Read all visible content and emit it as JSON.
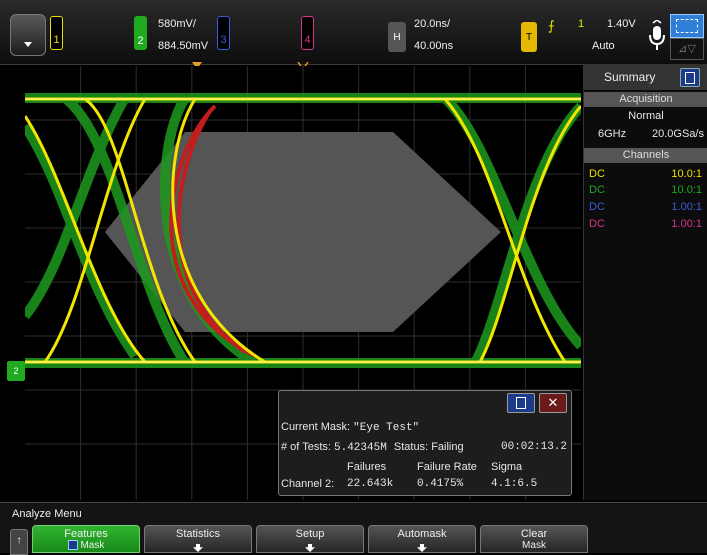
{
  "topbar": {
    "ch1": {
      "num": "1",
      "color": "#e8e000"
    },
    "ch2": {
      "num": "2",
      "color": "#1faa1f",
      "scale": "580mV/",
      "offset": "884.50mV"
    },
    "ch3": {
      "num": "3",
      "color": "#3b5bdb"
    },
    "ch4": {
      "num": "4",
      "color": "#d6338a"
    },
    "horizontal": {
      "label": "H",
      "timebase": "20.0ns/",
      "position": "40.00ns"
    },
    "trigger": {
      "label": "T",
      "source": "1",
      "level": "1.40V",
      "mode": "Auto"
    }
  },
  "side_panel": {
    "header": "Summary",
    "acquisition": {
      "title": "Acquisition",
      "mode": "Normal",
      "bandwidth": "6GHz",
      "rate": "20.0GSa/s"
    },
    "channels": {
      "title": "Channels",
      "rows": [
        {
          "coupling": "DC",
          "ratio": "10.0:1",
          "color": "#e8e000"
        },
        {
          "coupling": "DC",
          "ratio": "10.0:1",
          "color": "#1faa1f"
        },
        {
          "coupling": "DC",
          "ratio": "1.00:1",
          "color": "#3b5bdb"
        },
        {
          "coupling": "DC",
          "ratio": "1.00:1",
          "color": "#d6338a"
        }
      ]
    }
  },
  "mask_popup": {
    "current_mask_label": "Current Mask:",
    "current_mask_value": "\"Eye Test\"",
    "tests_label": "# of Tests:",
    "tests_value": "5.42345M",
    "status_label": "Status:",
    "status_value": "Failing",
    "elapsed": "00:02:13.2",
    "col_failures": "Failures",
    "col_rate": "Failure Rate",
    "col_sigma": "Sigma",
    "row_label": "Channel 2:",
    "failures": "22.643k",
    "rate": "0.4175%",
    "sigma": "4.1:6.5"
  },
  "bottom": {
    "menu_title": "Analyze Menu",
    "softkeys": {
      "features": "Features",
      "features_sub": "Mask",
      "statistics": "Statistics",
      "setup": "Setup",
      "automask": "Automask",
      "clear": "Clear",
      "clear_sub": "Mask"
    }
  },
  "markers": {
    "ch2_ground": "2"
  }
}
